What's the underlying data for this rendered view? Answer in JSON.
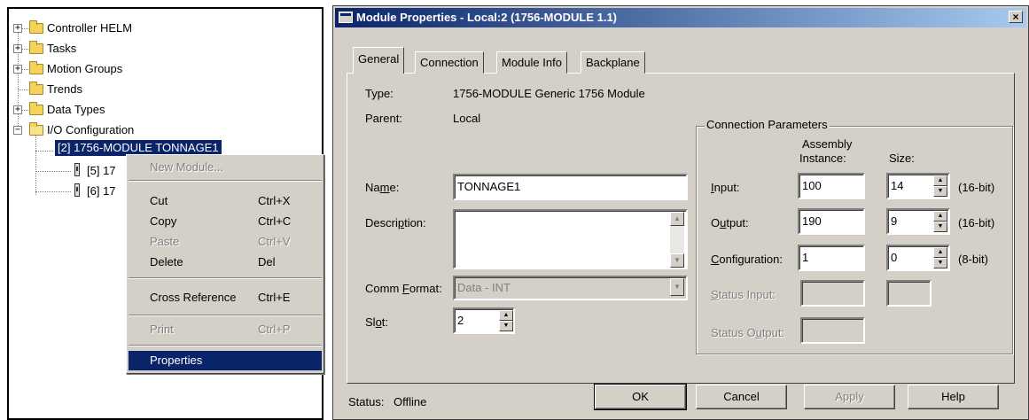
{
  "tree": {
    "items": [
      {
        "label": "Controller HELM",
        "icon": "folder-icon",
        "expander": "+"
      },
      {
        "label": "Tasks",
        "icon": "folder-icon",
        "expander": "+"
      },
      {
        "label": "Motion Groups",
        "icon": "folder-icon",
        "expander": "+"
      },
      {
        "label": "Trends",
        "icon": "folder-icon",
        "expander": ""
      },
      {
        "label": "Data Types",
        "icon": "folder-icon",
        "expander": "+"
      },
      {
        "label": "I/O Configuration",
        "icon": "open-folder-icon",
        "expander": "−"
      }
    ],
    "modules": [
      {
        "label": "[2] 1756-MODULE TONNAGE1",
        "selected": true
      },
      {
        "label": "[5] 17"
      },
      {
        "label": "[6] 17"
      }
    ]
  },
  "context_menu": {
    "items": [
      {
        "label": "New Module...",
        "shortcut": "",
        "disabled": true
      },
      {
        "label": "Cut",
        "shortcut": "Ctrl+X",
        "disabled": false
      },
      {
        "label": "Copy",
        "shortcut": "Ctrl+C",
        "disabled": false
      },
      {
        "label": "Paste",
        "shortcut": "Ctrl+V",
        "disabled": true
      },
      {
        "label": "Delete",
        "shortcut": "Del",
        "disabled": false
      },
      {
        "label": "Cross Reference",
        "shortcut": "Ctrl+E",
        "disabled": false
      },
      {
        "label": "Print",
        "shortcut": "Ctrl+P",
        "disabled": true
      },
      {
        "label": "Properties",
        "shortcut": "",
        "disabled": false,
        "highlighted": true
      }
    ]
  },
  "dialog": {
    "title": "Module Properties - Local:2 (1756-MODULE 1.1)",
    "close_glyph": "×",
    "tabs": [
      "General",
      "Connection",
      "Module Info",
      "Backplane"
    ],
    "active_tab": "General",
    "type_label": "Type:",
    "type_value": "1756-MODULE Generic 1756 Module",
    "parent_label": "Parent:",
    "parent_value": "Local",
    "name_label_pre": "Na",
    "name_label_ul": "m",
    "name_label_post": "e:",
    "name_value": "TONNAGE1",
    "description_label_pre": "Descri",
    "description_label_ul": "p",
    "description_label_post": "tion:",
    "description_value": "",
    "comm_format_label_pre": "Comm ",
    "comm_format_label_ul": "F",
    "comm_format_label_post": "ormat:",
    "comm_format_value": "Data - INT",
    "slot_label_pre": "Sl",
    "slot_label_ul": "o",
    "slot_label_post": "t:",
    "slot_value": "2",
    "connection": {
      "group_title": "Connection Parameters",
      "col_assembly": "Assembly",
      "col_instance": "Instance:",
      "col_size": "Size:",
      "rows": [
        {
          "pre": "",
          "ul": "I",
          "post": "nput:",
          "instance": "100",
          "size": "14",
          "unit": "(16-bit)",
          "disabled": false
        },
        {
          "pre": "O",
          "ul": "u",
          "post": "tput:",
          "instance": "190",
          "size": "9",
          "unit": "(16-bit)",
          "disabled": false
        },
        {
          "pre": "",
          "ul": "C",
          "post": "onfiguration:",
          "instance": "1",
          "size": "0",
          "unit": "(8-bit)",
          "disabled": false
        },
        {
          "pre": "",
          "ul": "S",
          "post": "tatus Input:",
          "instance": "",
          "size": "",
          "unit": "",
          "disabled": true
        },
        {
          "pre": "Status O",
          "ul": "u",
          "post": "tput:",
          "instance": "",
          "size": "",
          "unit": "",
          "disabled": true
        }
      ]
    },
    "status_label": "Status:",
    "status_value": "Offline",
    "buttons": {
      "ok": "OK",
      "cancel": "Cancel",
      "apply": "Apply",
      "help": "Help"
    }
  }
}
